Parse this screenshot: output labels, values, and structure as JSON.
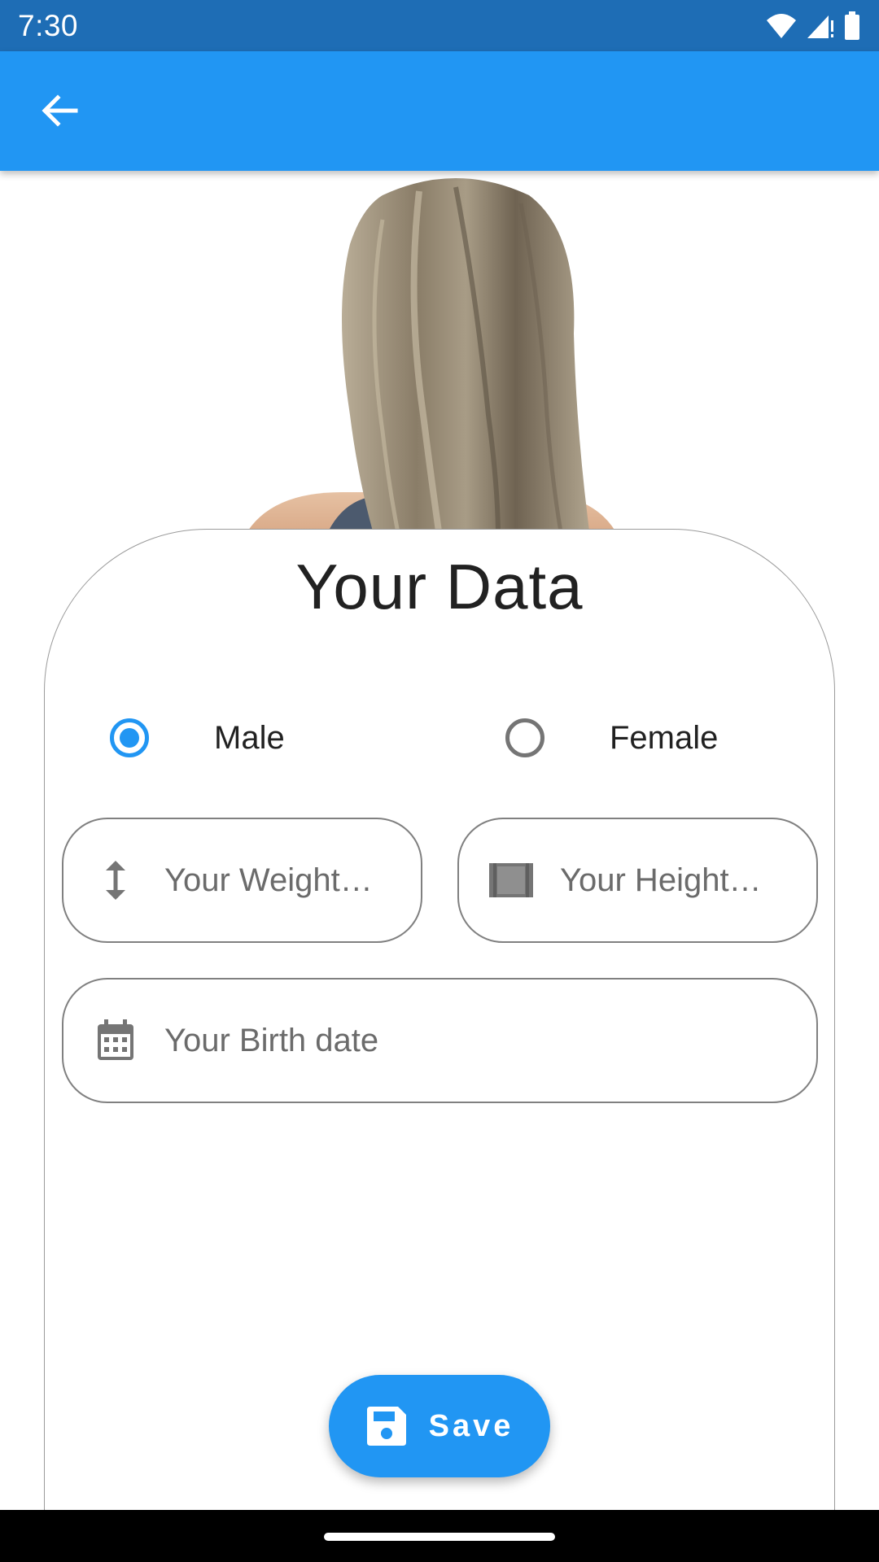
{
  "status_bar": {
    "time": "7:30",
    "icons": [
      "wifi-icon",
      "signal-icon",
      "battery-icon"
    ]
  },
  "app_bar": {
    "back_icon": "arrow-back-icon",
    "color": "#2196f3"
  },
  "hero": {
    "image": "woman-long-hair-back-view"
  },
  "form": {
    "title": "Your Data",
    "gender_options": [
      {
        "label": "Male",
        "selected": true
      },
      {
        "label": "Female",
        "selected": false
      }
    ],
    "weight_field": {
      "placeholder": "Your Weight…",
      "icon": "vertical-arrows-icon"
    },
    "height_field": {
      "placeholder": "Your Height…",
      "icon": "height-bar-icon"
    },
    "birth_field": {
      "placeholder": "Your Birth date",
      "icon": "calendar-icon"
    },
    "save_button": {
      "label": "Save",
      "icon": "floppy-disk-icon"
    }
  },
  "colors": {
    "status_bar": "#1e6db5",
    "accent": "#2196f3",
    "text": "#212121",
    "placeholder": "#6b6b6b"
  }
}
